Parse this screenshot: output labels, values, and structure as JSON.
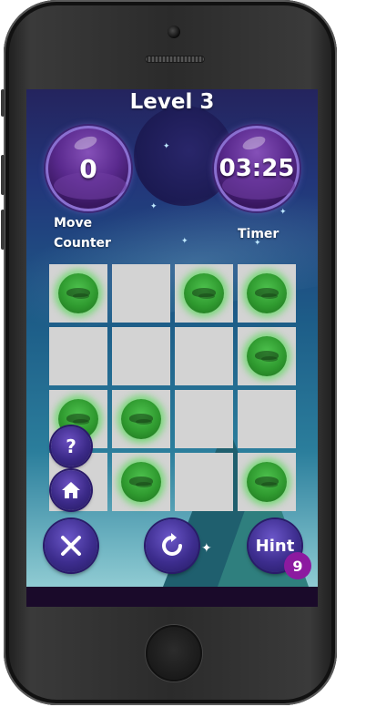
{
  "game": {
    "level_title": "Level 3",
    "move_counter": {
      "value": "0",
      "label_line1": "Move",
      "label_line2": "Counter"
    },
    "timer": {
      "value": "03:25",
      "label": "Timer"
    },
    "board": {
      "rows": [
        [
          true,
          false,
          true,
          true
        ],
        [
          false,
          false,
          false,
          true
        ],
        [
          true,
          true,
          false,
          false
        ],
        [
          false,
          true,
          false,
          true
        ]
      ]
    },
    "buttons": {
      "help_icon": "question-mark",
      "help_label": "?",
      "home_icon": "home-icon",
      "close_icon": "close-icon",
      "restart_icon": "restart-icon",
      "hint_label": "Hint",
      "hint_count": "9"
    },
    "colors": {
      "ball": "#3fb63f",
      "cell": "#d3d3d3",
      "orb": "#5a2a8e",
      "badge": "#8c1aa0"
    }
  }
}
